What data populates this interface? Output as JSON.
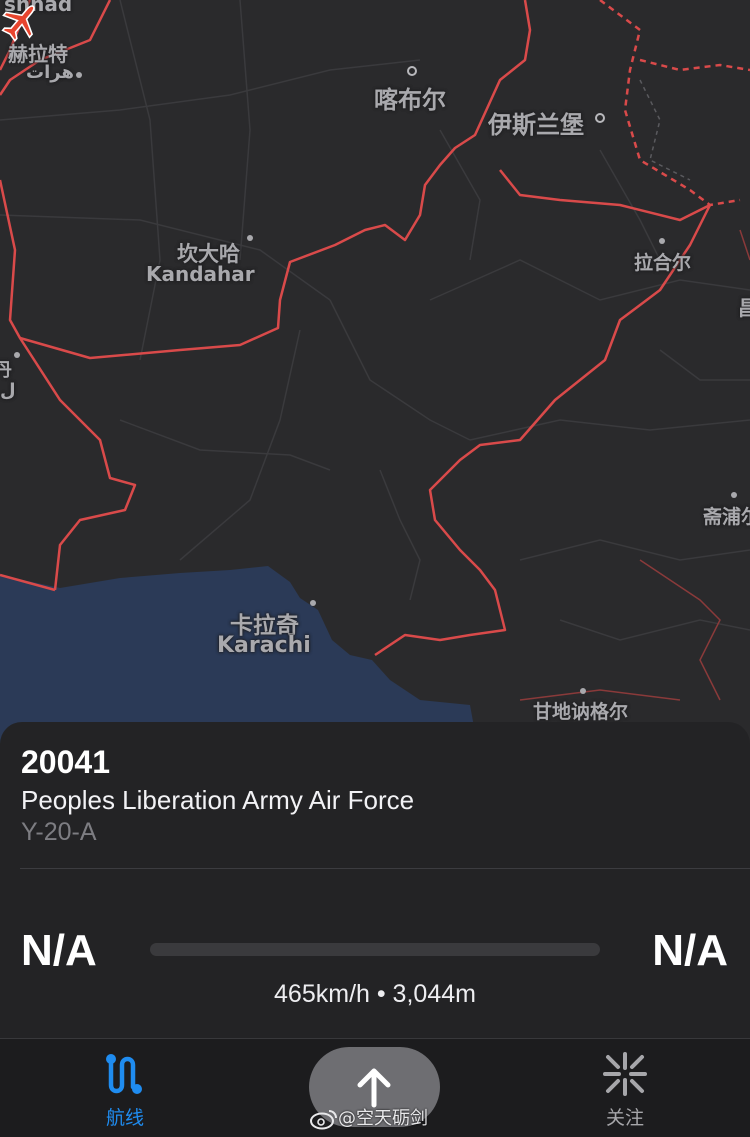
{
  "map": {
    "labels": {
      "mashhad": "shhad",
      "herat_zh": "赫拉特",
      "herat_fa": "هرات",
      "kabul": "喀布尔",
      "islamabad": "伊斯兰堡",
      "kandahar_zh": "坎大哈",
      "kandahar_en": "Kandahar",
      "lahore": "拉合尔",
      "edge_char": "昌",
      "left_edge_1": "丹",
      "left_edge_2": "ل",
      "bikaner": "斋浦尔",
      "karachi_zh": "卡拉奇",
      "karachi_en": "Karachi",
      "gandhinagar": "甘地讷格尔"
    },
    "colors": {
      "land": "#2a2a2c",
      "sea": "#2b3a57",
      "border": "#d94a4a",
      "aircraft": "#e8452e"
    }
  },
  "flight": {
    "callsign": "20041",
    "operator": "Peoples Liberation Army Air Force",
    "aircraft_type": "Y-20-A",
    "origin": "N/A",
    "destination": "N/A",
    "progress": 0,
    "speed_alt": "465km/h • 3,044m"
  },
  "tabbar": {
    "route_label": "航线",
    "follow_label": "关注",
    "accent": "#1f8cf0"
  },
  "watermark": "@空天砺剑"
}
